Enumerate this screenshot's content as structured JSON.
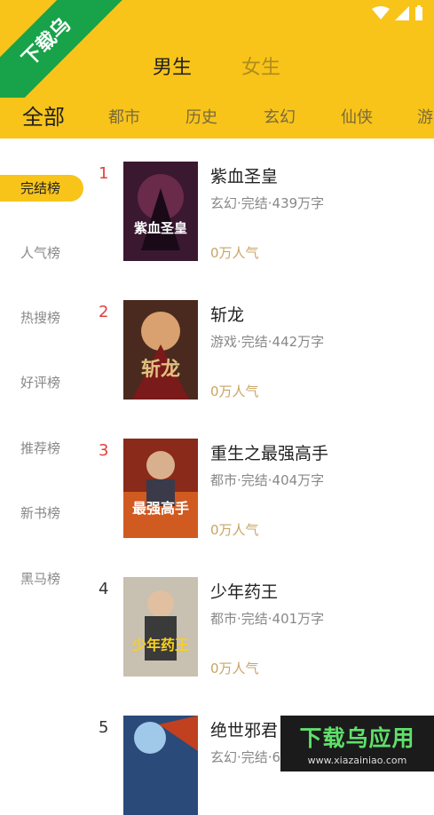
{
  "header": {
    "gender_tabs": [
      "男生",
      "女生"
    ],
    "categories": [
      "全部",
      "都市",
      "历史",
      "玄幻",
      "仙侠",
      "游"
    ]
  },
  "sidebar": {
    "items": [
      "完结榜",
      "人气榜",
      "热搜榜",
      "好评榜",
      "推荐榜",
      "新书榜",
      "黑马榜"
    ],
    "active": "完结榜"
  },
  "books": [
    {
      "rank": "1",
      "title": "紫血圣皇",
      "meta": "玄幻·完结·439万字",
      "popularity": "0万人气",
      "cover_text": "紫血圣皇",
      "cover_color": "#3a1830"
    },
    {
      "rank": "2",
      "title": "斩龙",
      "meta": "游戏·完结·442万字",
      "popularity": "0万人气",
      "cover_text": "斩龙",
      "cover_color": "#4a2a1e"
    },
    {
      "rank": "3",
      "title": "重生之最强高手",
      "meta": "都市·完结·404万字",
      "popularity": "0万人气",
      "cover_text": "最强高手",
      "cover_color": "#8a2a1a"
    },
    {
      "rank": "4",
      "title": "少年药王",
      "meta": "都市·完结·401万字",
      "popularity": "0万人气",
      "cover_text": "少年药王",
      "cover_color": "#5a4a3a"
    },
    {
      "rank": "5",
      "title": "绝世邪君",
      "meta": "玄幻·完结·6",
      "popularity": "",
      "cover_text": "",
      "cover_color": "#2a4a7a"
    }
  ],
  "watermark": {
    "corner": "下载乌",
    "brand": "下载乌应用",
    "url": "www.xiazainiao.com"
  },
  "colors": {
    "accent": "#f8c41a",
    "rank_top": "#e2413c",
    "popularity": "#c9a464"
  }
}
